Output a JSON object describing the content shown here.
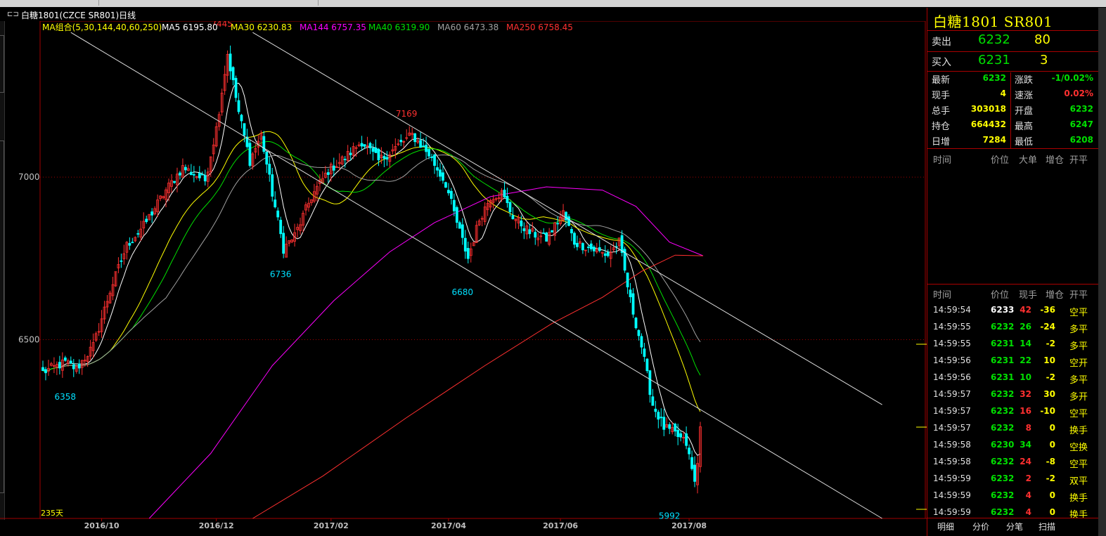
{
  "window": {
    "title": "白糖1801(CZCE SR801)日线"
  },
  "chart_data": {
    "type": "candlestick",
    "ma_header": [
      {
        "label": "MA组合(5,30,144,40,60,250)",
        "color": "#ffff00"
      },
      {
        "label": "MA5 6195.80",
        "color": "#ffffff"
      },
      {
        "label": "MA30 6230.83",
        "color": "#ffff00"
      },
      {
        "label": "MA144 6757.35",
        "color": "#ff00ff"
      },
      {
        "label": "MA40 6319.90",
        "color": "#00e000"
      },
      {
        "label": "MA60 6473.38",
        "color": "#a0a0a0"
      },
      {
        "label": "MA250 6758.45",
        "color": "#ff3030"
      }
    ],
    "y_ticks": [
      7000,
      6500
    ],
    "y_range": [
      5950,
      7480
    ],
    "x_ticks": [
      "2016/10",
      "2016/12",
      "2017/02",
      "2017/04",
      "2017/06",
      "2017/08"
    ],
    "x_tick_index": [
      21,
      62,
      103,
      145,
      185,
      231
    ],
    "bar_count": 236,
    "annotations": [
      {
        "text": "7445",
        "index": 66,
        "value": 7445,
        "color": "#ff3030"
      },
      {
        "text": "7169",
        "index": 132,
        "value": 7169,
        "color": "#ff3030"
      },
      {
        "text": "6736",
        "index": 87,
        "value": 6736,
        "color": "#00e0ff"
      },
      {
        "text": "6680",
        "index": 152,
        "value": 6680,
        "color": "#00e0ff"
      },
      {
        "text": "6358",
        "index": 10,
        "value": 6358,
        "color": "#00e0ff"
      },
      {
        "text": "5992",
        "index": 226,
        "value": 5992,
        "color": "#00e0ff"
      }
    ],
    "days_label": "235天",
    "trendlines": [
      {
        "from": [
          10,
          7445
        ],
        "to": [
          300,
          5950
        ]
      },
      {
        "from": [
          75,
          7445
        ],
        "to": [
          300,
          6300
        ]
      }
    ],
    "close_anchors": [
      [
        0,
        6400
      ],
      [
        8,
        6430
      ],
      [
        12,
        6410
      ],
      [
        18,
        6480
      ],
      [
        24,
        6650
      ],
      [
        30,
        6790
      ],
      [
        36,
        6850
      ],
      [
        44,
        6960
      ],
      [
        50,
        7030
      ],
      [
        58,
        6990
      ],
      [
        62,
        7150
      ],
      [
        66,
        7380
      ],
      [
        70,
        7200
      ],
      [
        74,
        7050
      ],
      [
        78,
        7130
      ],
      [
        82,
        6950
      ],
      [
        86,
        6780
      ],
      [
        90,
        6820
      ],
      [
        96,
        6940
      ],
      [
        102,
        7020
      ],
      [
        108,
        7060
      ],
      [
        114,
        7110
      ],
      [
        120,
        7050
      ],
      [
        126,
        7090
      ],
      [
        132,
        7130
      ],
      [
        138,
        7070
      ],
      [
        144,
        6980
      ],
      [
        148,
        6860
      ],
      [
        152,
        6750
      ],
      [
        156,
        6870
      ],
      [
        160,
        6940
      ],
      [
        164,
        6950
      ],
      [
        168,
        6880
      ],
      [
        174,
        6830
      ],
      [
        180,
        6810
      ],
      [
        186,
        6890
      ],
      [
        190,
        6800
      ],
      [
        196,
        6780
      ],
      [
        202,
        6760
      ],
      [
        206,
        6800
      ],
      [
        210,
        6620
      ],
      [
        214,
        6480
      ],
      [
        218,
        6300
      ],
      [
        222,
        6230
      ],
      [
        226,
        6210
      ],
      [
        230,
        6180
      ],
      [
        233,
        6060
      ],
      [
        236,
        6232
      ]
    ],
    "ma_lines": [
      {
        "name": "MA5",
        "color": "#ffffff",
        "lag": 3,
        "start": 0
      },
      {
        "name": "MA30",
        "color": "#ffff00",
        "lag": 12,
        "start": 0
      },
      {
        "name": "MA40",
        "color": "#00e000",
        "lag": 16,
        "start": 0
      },
      {
        "name": "MA60",
        "color": "#a0a0a0",
        "lag": 22,
        "start": 5
      },
      {
        "name": "MA144",
        "color": "#ff00ff",
        "points": [
          [
            38,
            5950
          ],
          [
            60,
            6150
          ],
          [
            82,
            6420
          ],
          [
            104,
            6620
          ],
          [
            124,
            6770
          ],
          [
            140,
            6860
          ],
          [
            160,
            6940
          ],
          [
            180,
            6970
          ],
          [
            200,
            6960
          ],
          [
            212,
            6910
          ],
          [
            224,
            6800
          ],
          [
            236,
            6758
          ]
        ]
      },
      {
        "name": "MA250",
        "color": "#ff3030",
        "points": [
          [
            75,
            5950
          ],
          [
            100,
            6080
          ],
          [
            130,
            6260
          ],
          [
            158,
            6420
          ],
          [
            182,
            6550
          ],
          [
            200,
            6630
          ],
          [
            214,
            6710
          ],
          [
            226,
            6760
          ],
          [
            236,
            6758
          ]
        ]
      }
    ]
  },
  "quote_panel": {
    "title": "白糖1801  SR801",
    "sell_label": "卖出",
    "sell_price": "6232",
    "sell_qty": "80",
    "buy_label": "买入",
    "buy_price": "6231",
    "buy_qty": "3",
    "stats_left": [
      {
        "label": "最新",
        "value": "6232",
        "color": "#00e000"
      },
      {
        "label": "现手",
        "value": "4",
        "color": "#ffff00"
      },
      {
        "label": "总手",
        "value": "303018",
        "color": "#ffff00"
      },
      {
        "label": "持仓",
        "value": "664432",
        "color": "#ffff00"
      },
      {
        "label": "日增",
        "value": "7284",
        "color": "#ffff00"
      }
    ],
    "stats_right": [
      {
        "label": "涨跌",
        "value": "-1/0.02%",
        "color": "#00e000"
      },
      {
        "label": "速涨",
        "value": "0.02%",
        "color": "#ff3030"
      },
      {
        "label": "开盘",
        "value": "6232",
        "color": "#00e000"
      },
      {
        "label": "最高",
        "value": "6247",
        "color": "#00e000"
      },
      {
        "label": "最低",
        "value": "6208",
        "color": "#00e000"
      }
    ],
    "big_orders_headers": [
      "时间",
      "价位",
      "大单",
      "增仓",
      "开平"
    ],
    "ticks_headers": [
      "时间",
      "价位",
      "现手",
      "增仓",
      "开平"
    ],
    "ticks": [
      {
        "time": "14:59:54",
        "price": "6233",
        "qty": "42",
        "chg": "-36",
        "type": "空平",
        "pc": "#ffffff",
        "qc": "#ff3030",
        "cc": "#ffff00",
        "tc": "#ffff00"
      },
      {
        "time": "14:59:55",
        "price": "6232",
        "qty": "26",
        "chg": "-24",
        "type": "多平",
        "pc": "#00e000",
        "qc": "#00e000",
        "cc": "#ffff00",
        "tc": "#ffff00"
      },
      {
        "time": "14:59:55",
        "price": "6231",
        "qty": "14",
        "chg": "-2",
        "type": "多平",
        "pc": "#00e000",
        "qc": "#00e000",
        "cc": "#ffff00",
        "tc": "#ffff00"
      },
      {
        "time": "14:59:56",
        "price": "6231",
        "qty": "22",
        "chg": "10",
        "type": "空开",
        "pc": "#00e000",
        "qc": "#00e000",
        "cc": "#ffff00",
        "tc": "#ffff00"
      },
      {
        "time": "14:59:56",
        "price": "6231",
        "qty": "10",
        "chg": "-2",
        "type": "多平",
        "pc": "#00e000",
        "qc": "#00e000",
        "cc": "#ffff00",
        "tc": "#ffff00"
      },
      {
        "time": "14:59:57",
        "price": "6232",
        "qty": "32",
        "chg": "30",
        "type": "多开",
        "pc": "#00e000",
        "qc": "#ff3030",
        "cc": "#ffff00",
        "tc": "#ffff00"
      },
      {
        "time": "14:59:57",
        "price": "6232",
        "qty": "16",
        "chg": "-10",
        "type": "空平",
        "pc": "#00e000",
        "qc": "#ff3030",
        "cc": "#ffff00",
        "tc": "#ffff00"
      },
      {
        "time": "14:59:57",
        "price": "6232",
        "qty": "8",
        "chg": "0",
        "type": "换手",
        "pc": "#00e000",
        "qc": "#ff3030",
        "cc": "#ffff00",
        "tc": "#ffff00"
      },
      {
        "time": "14:59:58",
        "price": "6230",
        "qty": "34",
        "chg": "0",
        "type": "空换",
        "pc": "#00e000",
        "qc": "#00e000",
        "cc": "#ffff00",
        "tc": "#ffff00"
      },
      {
        "time": "14:59:58",
        "price": "6232",
        "qty": "24",
        "chg": "-8",
        "type": "空平",
        "pc": "#00e000",
        "qc": "#ff3030",
        "cc": "#ffff00",
        "tc": "#ffff00"
      },
      {
        "time": "14:59:59",
        "price": "6232",
        "qty": "2",
        "chg": "-2",
        "type": "双平",
        "pc": "#00e000",
        "qc": "#ff3030",
        "cc": "#ffff00",
        "tc": "#ffff00"
      },
      {
        "time": "14:59:59",
        "price": "6232",
        "qty": "4",
        "chg": "0",
        "type": "换手",
        "pc": "#00e000",
        "qc": "#ff3030",
        "cc": "#ffff00",
        "tc": "#ffff00"
      },
      {
        "time": "14:59:59",
        "price": "6232",
        "qty": "4",
        "chg": "0",
        "type": "换手",
        "pc": "#00e000",
        "qc": "#ff3030",
        "cc": "#ffff00",
        "tc": "#ffff00"
      }
    ],
    "tabs": [
      "明细",
      "分价",
      "分笔",
      "扫描"
    ]
  }
}
